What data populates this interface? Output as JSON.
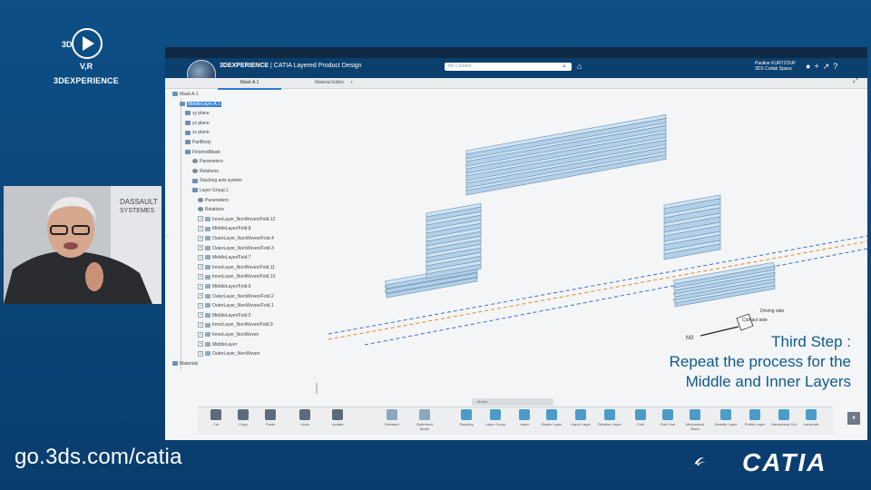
{
  "branding": {
    "logo_text_top": "3D",
    "logo_text_mid": "V,R",
    "logo_caption": "3DEXPERIENCE",
    "webcam_logo_line1": "DASSAULT",
    "webcam_logo_line2": "SYSTEMES",
    "website": "go.3ds.com/catia",
    "product": "CATIA"
  },
  "app": {
    "title_brand": "3DEXPERIENCE",
    "title_app": "CATIA Layered Product Design",
    "search_placeholder": "My Content",
    "user_name": "Pauline KURTZOUF",
    "user_space": "3DS Collab Space",
    "tabs": [
      "Mask A.1",
      "Material Editor"
    ],
    "tab_add": "+"
  },
  "tree": [
    {
      "label": "Mask A.1",
      "level": 0,
      "icon": "product-icon"
    },
    {
      "label": "MiddleLayer A.1",
      "level": 1,
      "icon": "layer-icon",
      "selected": true
    },
    {
      "label": "xy plane",
      "level": 2,
      "icon": "plane-icon"
    },
    {
      "label": "yz plane",
      "level": 2,
      "icon": "plane-icon"
    },
    {
      "label": "zx plane",
      "level": 2,
      "icon": "plane-icon"
    },
    {
      "label": "PartBody",
      "level": 2,
      "icon": "body-icon"
    },
    {
      "label": "FinishedMask",
      "level": 2,
      "icon": "body-icon"
    },
    {
      "label": "Parameters",
      "level": 3,
      "icon": "parameters-icon"
    },
    {
      "label": "Relations",
      "level": 3,
      "icon": "relations-icon"
    },
    {
      "label": "Stacking axis system",
      "level": 3,
      "icon": "axis-icon"
    },
    {
      "label": "Layer Group.1",
      "level": 3,
      "icon": "layer-group-icon"
    },
    {
      "label": "Parameters",
      "level": 4,
      "icon": "parameters-icon"
    },
    {
      "label": "Relations",
      "level": 4,
      "icon": "relations-icon"
    },
    {
      "label": "InnerLayer_NonWoven/Fold.12",
      "level": 4,
      "icon": "ply-icon"
    },
    {
      "label": "MiddleLayer/Fold.8",
      "level": 4,
      "icon": "ply-icon"
    },
    {
      "label": "OuterLayer_NonWoven/Fold.4",
      "level": 4,
      "icon": "ply-icon"
    },
    {
      "label": "OuterLayer_NonWoven/Fold.3",
      "level": 4,
      "icon": "ply-icon"
    },
    {
      "label": "MiddleLayer/Fold.7",
      "level": 4,
      "icon": "ply-icon"
    },
    {
      "label": "InnerLayer_NonWoven/Fold.11",
      "level": 4,
      "icon": "ply-icon"
    },
    {
      "label": "InnerLayer_NonWoven/Fold.10",
      "level": 4,
      "icon": "ply-icon"
    },
    {
      "label": "MiddleLayer/Fold.6",
      "level": 4,
      "icon": "ply-icon"
    },
    {
      "label": "OuterLayer_NonWoven/Fold.2",
      "level": 4,
      "icon": "ply-icon"
    },
    {
      "label": "OuterLayer_NonWoven/Fold.1",
      "level": 4,
      "icon": "ply-icon"
    },
    {
      "label": "MiddleLayer/Fold.5",
      "level": 4,
      "icon": "ply-icon"
    },
    {
      "label": "InnerLayer_NonWoven/Fold.9",
      "level": 4,
      "icon": "ply-icon"
    },
    {
      "label": "InnerLayer_NonWoven",
      "level": 4,
      "icon": "ply-icon"
    },
    {
      "label": "MiddleLayer",
      "level": 4,
      "icon": "ply-icon"
    },
    {
      "label": "OuterLayer_NonWoven",
      "level": 4,
      "icon": "ply-icon"
    },
    {
      "label": "Materials",
      "level": 0,
      "icon": "materials-icon"
    }
  ],
  "viewport": {
    "annotation_1": "Driving side",
    "annotation_2": "Contact side",
    "axis_label": "M3"
  },
  "caption": {
    "line1": "Third Step :",
    "line2": "Repeat the process for the",
    "line3": "Middle and Inner Layers"
  },
  "pager_label": "Model",
  "toolbar": [
    {
      "label": "Cut",
      "icon": "scissors-icon"
    },
    {
      "label": "Copy",
      "icon": "copy-icon"
    },
    {
      "label": "Paste",
      "icon": "paste-icon"
    },
    {
      "label": "Undo",
      "icon": "undo-icon"
    },
    {
      "label": "Update",
      "icon": "update-icon"
    },
    {
      "label": "Elevated",
      "icon": "elevated-icon"
    },
    {
      "label": "Optimized Mode",
      "icon": "optimized-mode-icon"
    },
    {
      "label": "Stacking",
      "icon": "stacking-icon"
    },
    {
      "label": "Layer Group",
      "icon": "layer-group-icon"
    },
    {
      "label": "Layer",
      "icon": "layer-icon"
    },
    {
      "label": "Elastic Layer",
      "icon": "elastic-layer-icon"
    },
    {
      "label": "Liquid Layer",
      "icon": "liquid-layer-icon"
    },
    {
      "label": "Relative Layer",
      "icon": "relative-layer-icon"
    },
    {
      "label": "Fold",
      "icon": "fold-icon"
    },
    {
      "label": "Fold Line",
      "icon": "fold-line-icon"
    },
    {
      "label": "Mechanical Bond",
      "icon": "mechanical-bond-icon"
    },
    {
      "label": "Density Layer",
      "icon": "density-layer-icon"
    },
    {
      "label": "Profile Layer",
      "icon": "profile-layer-icon"
    },
    {
      "label": "Mechanical Cut",
      "icon": "mechanical-cut-icon"
    },
    {
      "label": "Laminate",
      "icon": "laminate-icon"
    }
  ],
  "colors": {
    "background": "#0d4f86",
    "accent": "#2a7ac9",
    "caption": "#0f5a8e",
    "layer_fill": "#cfe3f3",
    "layer_stroke": "#6b8fae"
  }
}
